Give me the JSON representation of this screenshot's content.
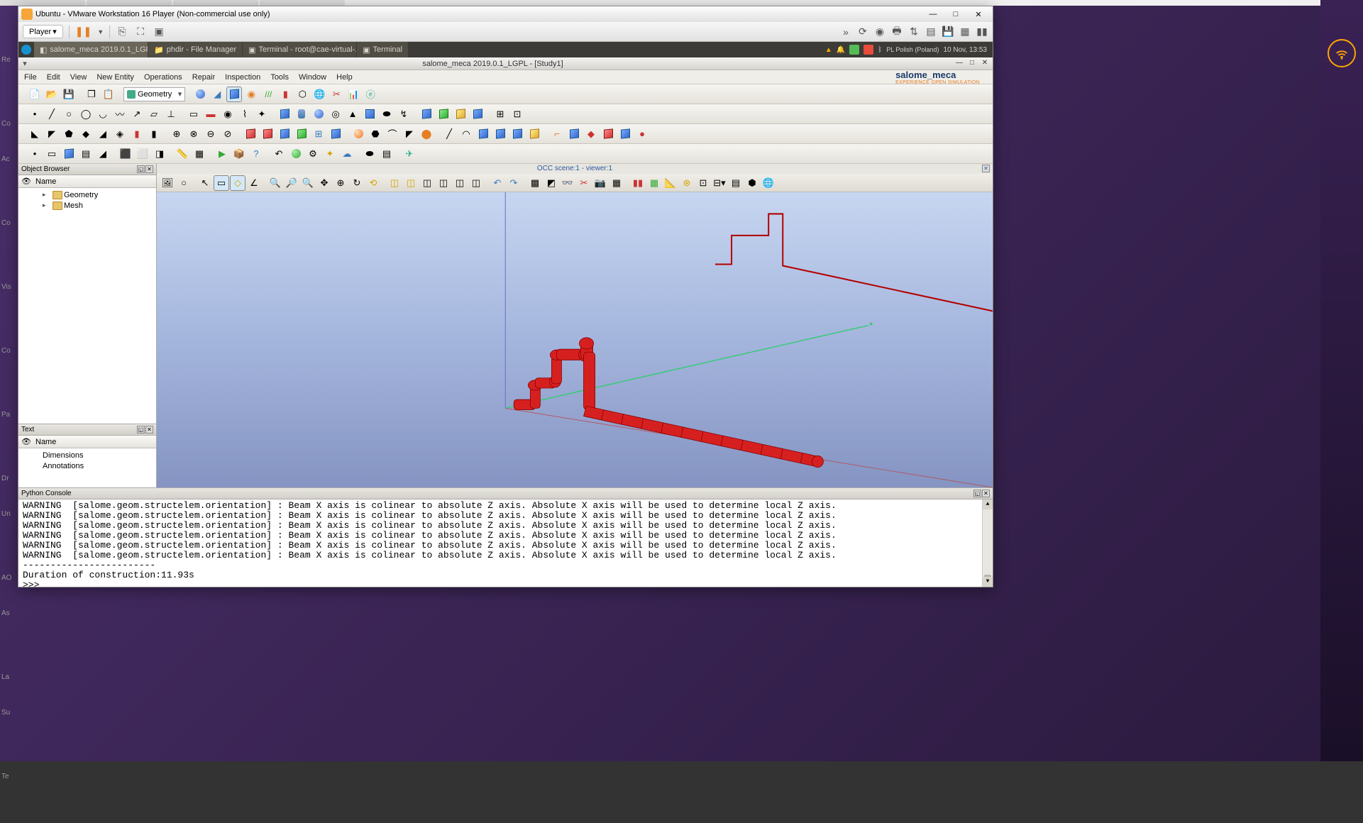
{
  "host": {
    "vmware_title": "Ubuntu - VMware Workstation 16 Player (Non-commercial use only)",
    "player_btn": "Player",
    "left_items": [
      "Re",
      "Co",
      "Ac",
      "Co",
      "Vis",
      "Co",
      "Pa",
      "Dr",
      "Un",
      "AO",
      "As",
      "La",
      "Su",
      "Te"
    ]
  },
  "ubuntu_taskbar": {
    "items": [
      "salome_meca 2019.0.1_LGPL...",
      "phdir - File Manager",
      "Terminal - root@cae-virtual-...",
      "Terminal"
    ],
    "locale": "PL Polish (Poland)",
    "clock": "10 Nov, 13:53"
  },
  "salome": {
    "title": "salome_meca 2019.0.1_LGPL - [Study1]",
    "menu": [
      "File",
      "Edit",
      "View",
      "New Entity",
      "Operations",
      "Repair",
      "Inspection",
      "Tools",
      "Window",
      "Help"
    ],
    "brand": "salome_meca",
    "tagline": "EXPERIENCE OPEN SIMULATION",
    "module_combo": "Geometry"
  },
  "panels": {
    "object_browser": {
      "title": "Object Browser",
      "col": "Name",
      "nodes": [
        "Geometry",
        "Mesh"
      ]
    },
    "text": {
      "title": "Text",
      "col": "Name",
      "items": [
        "Dimensions",
        "Annotations"
      ]
    }
  },
  "viewer": {
    "title": "OCC scene:1 - viewer:1"
  },
  "python_console": {
    "title": "Python Console",
    "lines": [
      "WARNING  [salome.geom.structelem.orientation] : Beam X axis is colinear to absolute Z axis. Absolute X axis will be used to determine local Z axis.",
      "WARNING  [salome.geom.structelem.orientation] : Beam X axis is colinear to absolute Z axis. Absolute X axis will be used to determine local Z axis.",
      "WARNING  [salome.geom.structelem.orientation] : Beam X axis is colinear to absolute Z axis. Absolute X axis will be used to determine local Z axis.",
      "WARNING  [salome.geom.structelem.orientation] : Beam X axis is colinear to absolute Z axis. Absolute X axis will be used to determine local Z axis.",
      "WARNING  [salome.geom.structelem.orientation] : Beam X axis is colinear to absolute Z axis. Absolute X axis will be used to determine local Z axis.",
      "WARNING  [salome.geom.structelem.orientation] : Beam X axis is colinear to absolute Z axis. Absolute X axis will be used to determine local Z axis.",
      "------------------------",
      "Duration of construction:11.93s",
      ">>> "
    ]
  }
}
